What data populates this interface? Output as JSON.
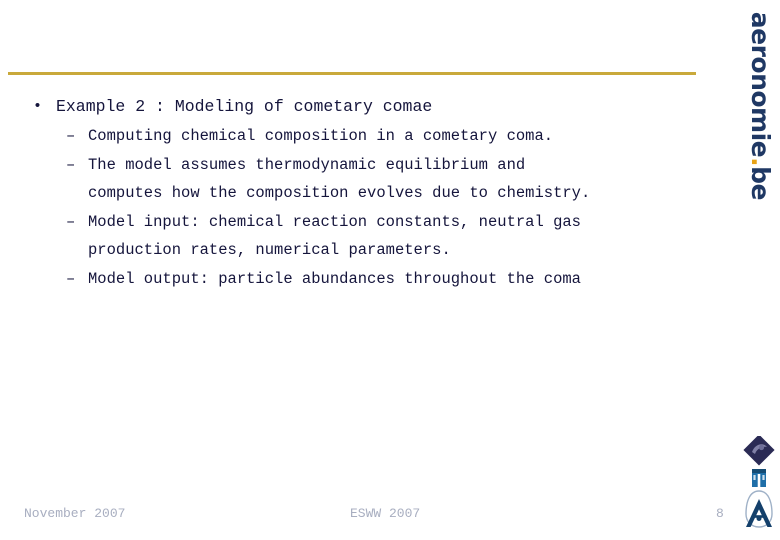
{
  "slide": {
    "page_number": "8",
    "accent_rule_color": "#c9a93b",
    "text_color": "#15153c",
    "footer_color": "#a8aec0",
    "brand_color": "#1f3864",
    "brand_dot_color": "#e8a317"
  },
  "brand": {
    "name": "aeronomie",
    "dot": ".",
    "tld": "be"
  },
  "content": {
    "bullets": [
      {
        "level": 1,
        "marker": "•",
        "text": "Example 2 : Modeling of cometary comae"
      },
      {
        "level": 2,
        "marker": "–",
        "text": "Computing chemical composition in a cometary coma."
      },
      {
        "level": 2,
        "marker": "–",
        "text": "The model assumes thermodynamic equilibrium and",
        "continuation": "computes how the composition evolves due to chemistry."
      },
      {
        "level": 2,
        "marker": "–",
        "text": "Model input: chemical reaction constants, neutral gas",
        "continuation": "production rates, numerical parameters."
      },
      {
        "level": 2,
        "marker": "–",
        "text": "Model output: particle abundances throughout the coma"
      }
    ]
  },
  "footer": {
    "date": "November 2007",
    "event": "ESWW 2007",
    "page": "8"
  },
  "logos": {
    "diamond": "bira-iasb-diamond-logo",
    "building": "institute-building-logo",
    "antenna": "antenna-radome-logo"
  }
}
